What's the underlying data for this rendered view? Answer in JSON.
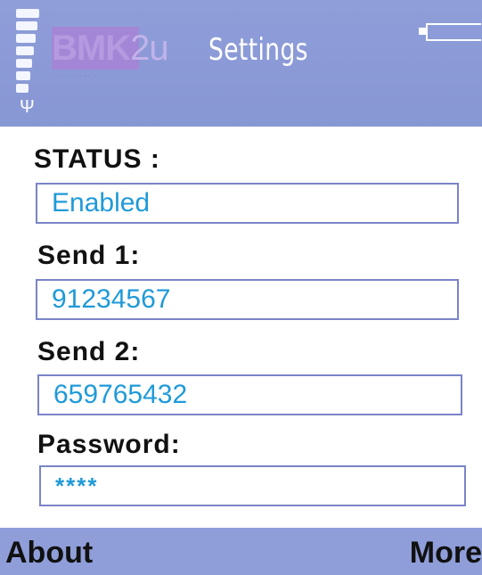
{
  "header": {
    "logo_text": "BMK",
    "logo_suffix": "2u",
    "title": "Settings",
    "icons": {
      "signal": "signal-strength-icon",
      "antenna": "antenna-icon",
      "battery": "battery-icon"
    }
  },
  "form": {
    "status": {
      "label": "STATUS :",
      "value": "Enabled"
    },
    "send1": {
      "label": "Send 1:",
      "value": "91234567"
    },
    "send2": {
      "label": "Send 2:",
      "value": "659765432"
    },
    "password": {
      "label": "Password:",
      "value": "****"
    }
  },
  "softkeys": {
    "left": "About",
    "right": "More"
  },
  "colors": {
    "header_bg": "#8f9ed9",
    "field_text": "#1f9ad8",
    "field_border": "#7a84c8",
    "label_text": "#111111"
  }
}
